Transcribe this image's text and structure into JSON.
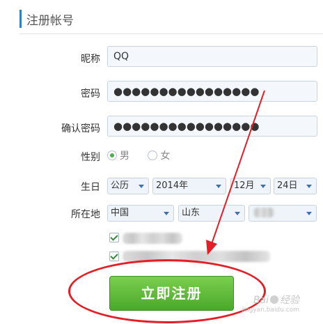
{
  "header": {
    "title": "注册帐号"
  },
  "form": {
    "nickname": {
      "label": "昵称",
      "value": "QQ"
    },
    "password": {
      "label": "密码",
      "value": "●●●●●●●●●●●●●●●●"
    },
    "confirm_password": {
      "label": "确认密码",
      "value": "●●●●●●●●●●●●●●●●"
    },
    "gender": {
      "label": "性别",
      "options": [
        "男",
        "女"
      ],
      "selected": "男"
    },
    "birthday": {
      "label": "生日",
      "calendar": "公历",
      "year": "2014年",
      "month": "12月",
      "day": "24日"
    },
    "location": {
      "label": "所在地",
      "country": "中国",
      "province": "山东",
      "city": ""
    }
  },
  "submit": {
    "label": "立即注册"
  },
  "watermark": {
    "text": "Bai",
    "suffix": "经验",
    "subtext": "jingyan.baidu.com"
  },
  "colors": {
    "accent": "#2f7fc8",
    "button": "#5bb836",
    "annotation": "#e41e26"
  }
}
